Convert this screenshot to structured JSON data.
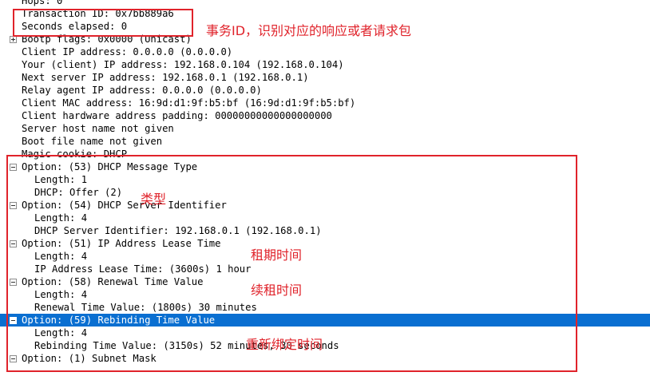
{
  "tree": [
    {
      "text": "Hops: 0",
      "level": 0,
      "expander": "none"
    },
    {
      "text": "Transaction ID: 0x7bb889a6",
      "level": 0,
      "expander": "none"
    },
    {
      "text": "Seconds elapsed: 0",
      "level": 0,
      "expander": "none"
    },
    {
      "text": "Bootp flags: 0x0000 (Unicast)",
      "level": 0,
      "expander": "plus"
    },
    {
      "text": "Client IP address: 0.0.0.0 (0.0.0.0)",
      "level": 0,
      "expander": "none"
    },
    {
      "text": "Your (client) IP address: 192.168.0.104 (192.168.0.104)",
      "level": 0,
      "expander": "none"
    },
    {
      "text": "Next server IP address: 192.168.0.1 (192.168.0.1)",
      "level": 0,
      "expander": "none"
    },
    {
      "text": "Relay agent IP address: 0.0.0.0 (0.0.0.0)",
      "level": 0,
      "expander": "none"
    },
    {
      "text": "Client MAC address: 16:9d:d1:9f:b5:bf (16:9d:d1:9f:b5:bf)",
      "level": 0,
      "expander": "none"
    },
    {
      "text": "Client hardware address padding: 00000000000000000000",
      "level": 0,
      "expander": "none"
    },
    {
      "text": "Server host name not given",
      "level": 0,
      "expander": "none"
    },
    {
      "text": "Boot file name not given",
      "level": 0,
      "expander": "none"
    },
    {
      "text": "Magic cookie: DHCP",
      "level": 0,
      "expander": "none"
    },
    {
      "text": "Option: (53) DHCP Message Type",
      "level": 0,
      "expander": "minus"
    },
    {
      "text": "Length: 1",
      "level": 1,
      "expander": "none"
    },
    {
      "text": "DHCP: Offer (2)",
      "level": 1,
      "expander": "none"
    },
    {
      "text": "Option: (54) DHCP Server Identifier",
      "level": 0,
      "expander": "minus"
    },
    {
      "text": "Length: 4",
      "level": 1,
      "expander": "none"
    },
    {
      "text": "DHCP Server Identifier: 192.168.0.1 (192.168.0.1)",
      "level": 1,
      "expander": "none"
    },
    {
      "text": "Option: (51) IP Address Lease Time",
      "level": 0,
      "expander": "minus"
    },
    {
      "text": "Length: 4",
      "level": 1,
      "expander": "none"
    },
    {
      "text": "IP Address Lease Time: (3600s) 1 hour",
      "level": 1,
      "expander": "none"
    },
    {
      "text": "Option: (58) Renewal Time Value",
      "level": 0,
      "expander": "minus"
    },
    {
      "text": "Length: 4",
      "level": 1,
      "expander": "none"
    },
    {
      "text": "Renewal Time Value: (1800s) 30 minutes",
      "level": 1,
      "expander": "none"
    },
    {
      "text": "Option: (59) Rebinding Time Value",
      "level": 0,
      "expander": "minus",
      "selected": true
    },
    {
      "text": "Length: 4",
      "level": 1,
      "expander": "none"
    },
    {
      "text": "Rebinding Time Value: (3150s) 52 minutes, 30 seconds",
      "level": 1,
      "expander": "none"
    },
    {
      "text": "Option: (1) Subnet Mask",
      "level": 0,
      "expander": "minus"
    }
  ],
  "annotations": {
    "transaction_note": "事务ID，识别对应的响应或者请求包",
    "type_note": "类型",
    "lease_note": "租期时间",
    "renewal_note": "续租时间",
    "rebinding_note": "重新绑定时间"
  },
  "colors": {
    "selection": "#0a6fd1",
    "annotation": "#e0232b"
  }
}
